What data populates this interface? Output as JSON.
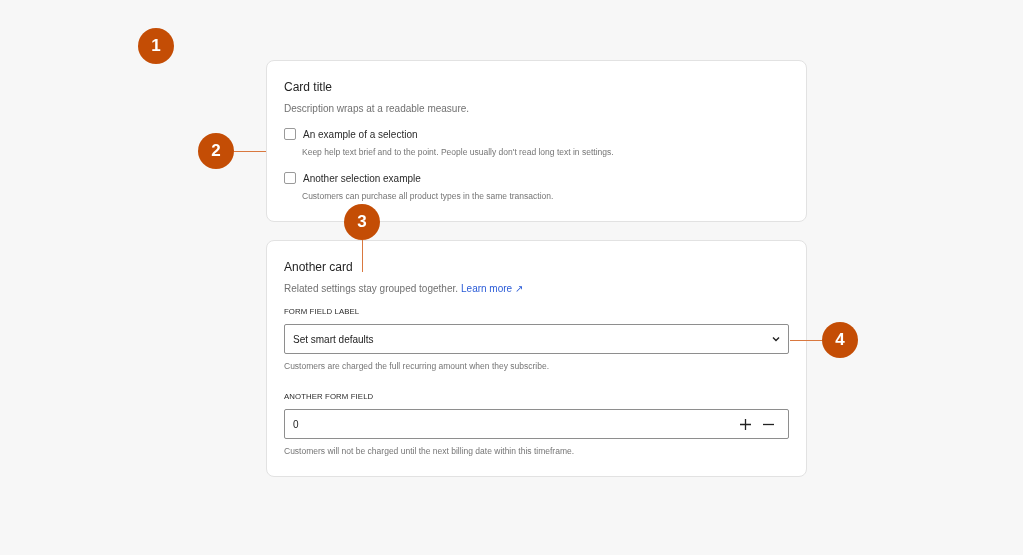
{
  "cards": [
    {
      "title": "Card title",
      "description": "Description wraps at a readable measure.",
      "items": [
        {
          "kind": "checkbox",
          "label": "An example of a selection",
          "checked": false,
          "help": "Keep help text brief and to the point. People usually don't read long text in settings."
        },
        {
          "kind": "checkbox",
          "label": "Another selection example",
          "checked": false,
          "help": "Customers can purchase all product types in the same transaction."
        }
      ]
    },
    {
      "title": "Another card",
      "description": "Related settings stay grouped together.",
      "link": "Learn more ↗",
      "items": [
        {
          "kind": "select",
          "label": "FORM FIELD LABEL",
          "value": "Set smart defaults",
          "help": "Customers are charged the full recurring amount when they subscribe."
        },
        {
          "kind": "number",
          "label": "ANOTHER FORM FIELD",
          "value": "0",
          "help": "Customers will not be charged until the next billing date within this timeframe."
        }
      ]
    }
  ],
  "annotations": [
    {
      "label": "1",
      "kind": "plain"
    },
    {
      "label": "2",
      "kind": "line-right"
    },
    {
      "label": "3",
      "kind": "line-down"
    },
    {
      "label": "4",
      "kind": "line-left"
    }
  ]
}
